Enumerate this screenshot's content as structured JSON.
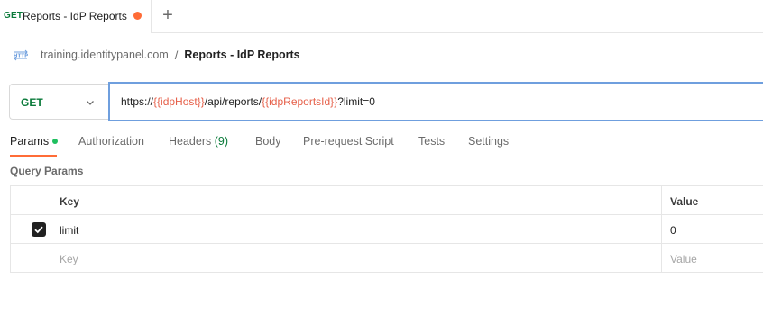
{
  "tab": {
    "method": "GET",
    "title": "Reports - IdP Reports",
    "unsaved_indicator": "orange-dot",
    "new_tab_label": "+"
  },
  "breadcrumb": {
    "icon": "http-icon",
    "collection": "training.identitypanel.com",
    "separator": "/",
    "request": "Reports - IdP Reports"
  },
  "request": {
    "method": "GET",
    "url_parts": {
      "prefix": "https://",
      "var1": "{{idpHost}}",
      "middle": "/api/reports/",
      "var2": "{{idpReportsId}}",
      "suffix": "?limit=0"
    }
  },
  "request_tabs": [
    {
      "label": "Params",
      "active": true,
      "indicator": "green-dot"
    },
    {
      "label": "Authorization"
    },
    {
      "label": "Headers",
      "count": "(9)"
    },
    {
      "label": "Body"
    },
    {
      "label": "Pre-request Script"
    },
    {
      "label": "Tests"
    },
    {
      "label": "Settings"
    }
  ],
  "query_params": {
    "title": "Query Params",
    "headers": {
      "key": "Key",
      "value": "Value"
    },
    "rows": [
      {
        "checked": true,
        "key": "limit",
        "value": "0"
      }
    ],
    "placeholder": {
      "key": "Key",
      "value": "Value"
    }
  },
  "colors": {
    "get_method": "#0a7a3a",
    "variable": "#e6604a",
    "accent": "#ff6c37",
    "url_focus_border": "#6f9fde",
    "params_dot": "#1fbf5f"
  }
}
